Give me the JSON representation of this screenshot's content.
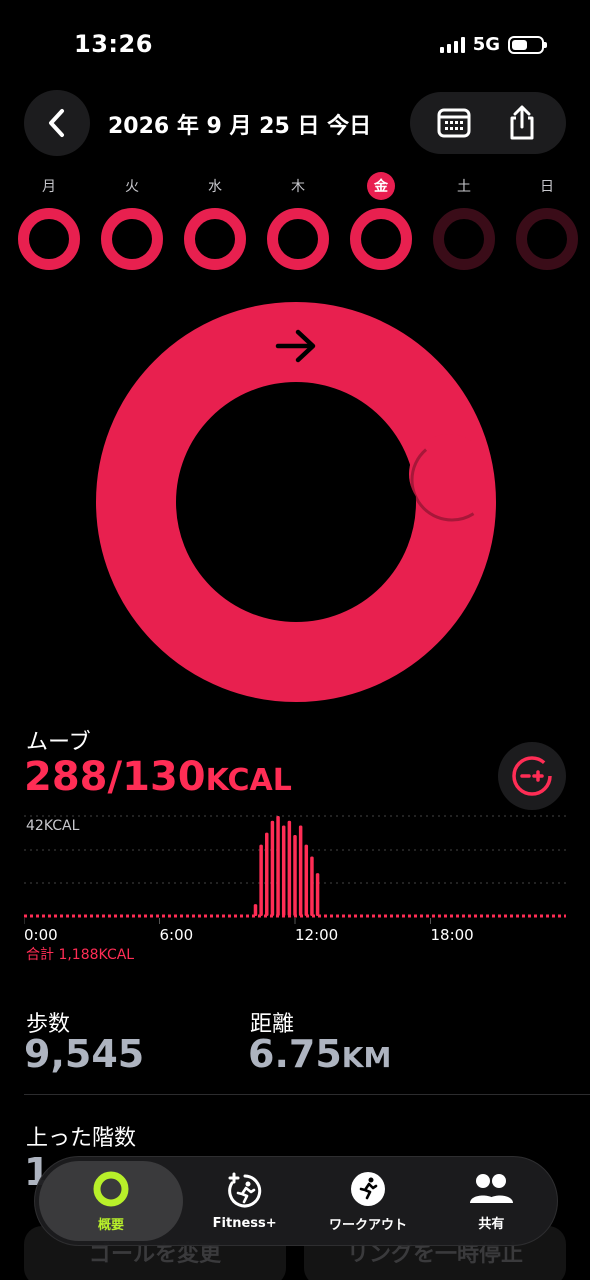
{
  "status_bar": {
    "time": "13:26",
    "network": "5G",
    "battery_fraction": 0.55
  },
  "header": {
    "title": "2026 年 9 月 25 日 今日"
  },
  "week": [
    {
      "label": "月",
      "today": false,
      "future": false
    },
    {
      "label": "火",
      "today": false,
      "future": false
    },
    {
      "label": "水",
      "today": false,
      "future": false
    },
    {
      "label": "木",
      "today": false,
      "future": false
    },
    {
      "label": "金",
      "today": true,
      "future": false
    },
    {
      "label": "土",
      "today": false,
      "future": true
    },
    {
      "label": "日",
      "today": false,
      "future": true
    }
  ],
  "colors": {
    "move": "#ff2d55",
    "ring": "#e8204f",
    "accent_tab": "#b8f02a"
  },
  "move": {
    "title": "ムーブ",
    "value": "288/130",
    "unit": "KCAL",
    "progress_fraction": 2.22
  },
  "chart_data": {
    "type": "bar",
    "title": "",
    "y_max_label": "42KCAL",
    "ylim": [
      0,
      42
    ],
    "x_ticks": [
      "0:00",
      "6:00",
      "12:00",
      "18:00"
    ],
    "total_label": "合計 1,188KCAL",
    "x_hours": [
      10.25,
      10.5,
      10.75,
      11.0,
      11.25,
      11.5,
      11.75,
      12.0,
      12.25,
      12.5,
      12.75,
      13.0
    ],
    "values": [
      5,
      30,
      35,
      40,
      42,
      38,
      40,
      34,
      38,
      30,
      25,
      18
    ]
  },
  "stats": {
    "steps": {
      "label": "歩数",
      "value": "9,545"
    },
    "distance": {
      "label": "距離",
      "value": "6.75",
      "unit": "KM"
    },
    "floors": {
      "label": "上った階数",
      "value": "1"
    }
  },
  "bottom_buttons": {
    "change_goal": "ゴールを変更",
    "pause_ring": "リングを一時停止"
  },
  "tabs": [
    {
      "label": "概要",
      "icon": "activity-ring-icon",
      "active": true
    },
    {
      "label": "Fitness+",
      "icon": "fitness-plus-icon",
      "active": false
    },
    {
      "label": "ワークアウト",
      "icon": "workout-runner-icon",
      "active": false
    },
    {
      "label": "共有",
      "icon": "sharing-people-icon",
      "active": false
    }
  ]
}
